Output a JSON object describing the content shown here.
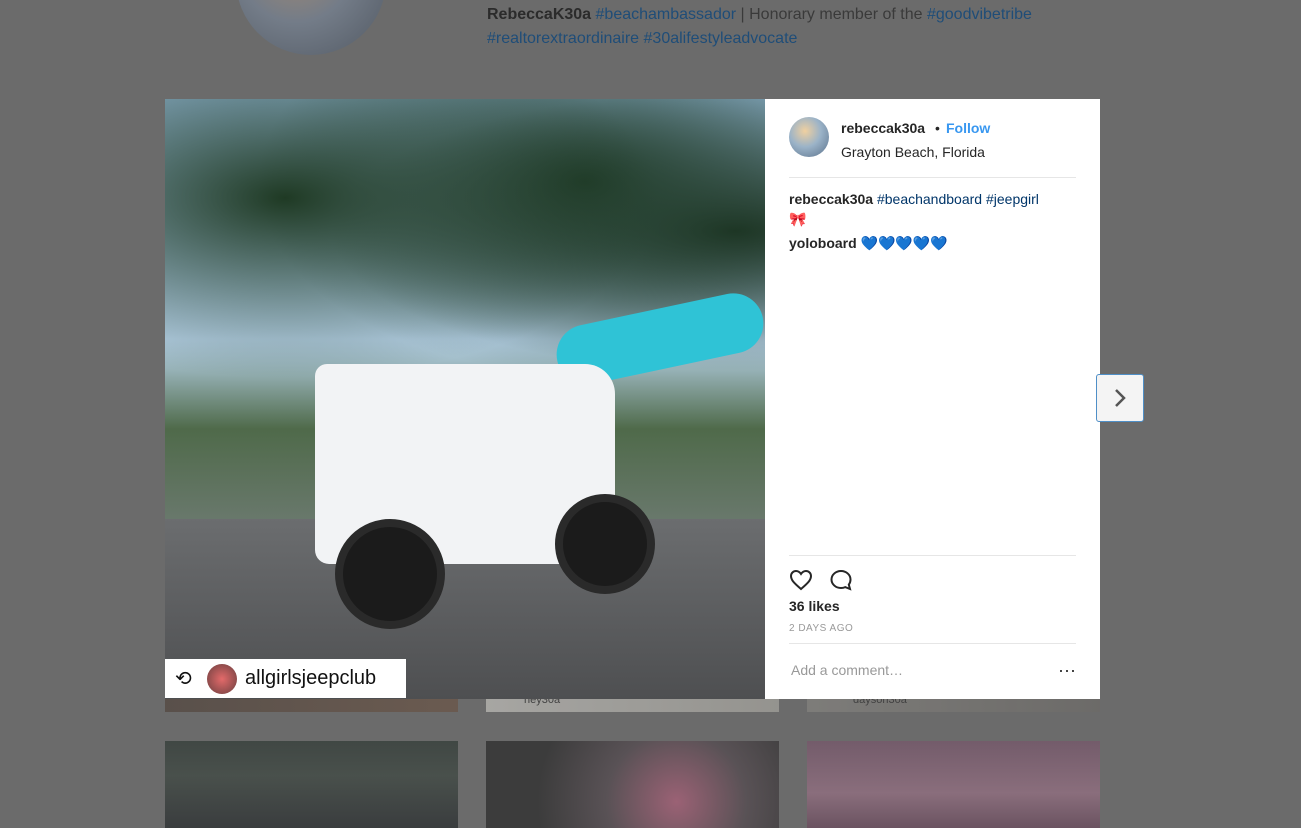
{
  "background": {
    "bio": {
      "username": "RebeccaK30a",
      "tag1": "#beachambassador",
      "sep": " | Honorary member of the ",
      "tag2": "#goodvibetribe",
      "tag3": "#realtorextraordinaire",
      "tag4": "#30alifestyleadvocate"
    },
    "thumb_captions": [
      "hey30a",
      "dayson30a"
    ]
  },
  "post": {
    "repost_badge": {
      "username": "allgirlsjeepclub"
    },
    "header": {
      "username": "rebeccak30a",
      "separator": "•",
      "follow_label": "Follow",
      "location": "Grayton Beach, Florida"
    },
    "caption": {
      "username": "rebeccak30a",
      "hashtag1": "#beachandboard",
      "hashtag2": "#jeepgirl",
      "emoji": "🎀",
      "line2": "yoloboard 💙💙💙💙💙"
    },
    "likes": "36 likes",
    "time_ago": "2 DAYS AGO",
    "comment_placeholder": "Add a comment…",
    "more_label": "···"
  },
  "icons": {
    "heart": "heart-icon",
    "comment": "comment-icon",
    "repost": "repost-icon",
    "next": "chevron-right-icon",
    "more": "more-options-icon"
  }
}
